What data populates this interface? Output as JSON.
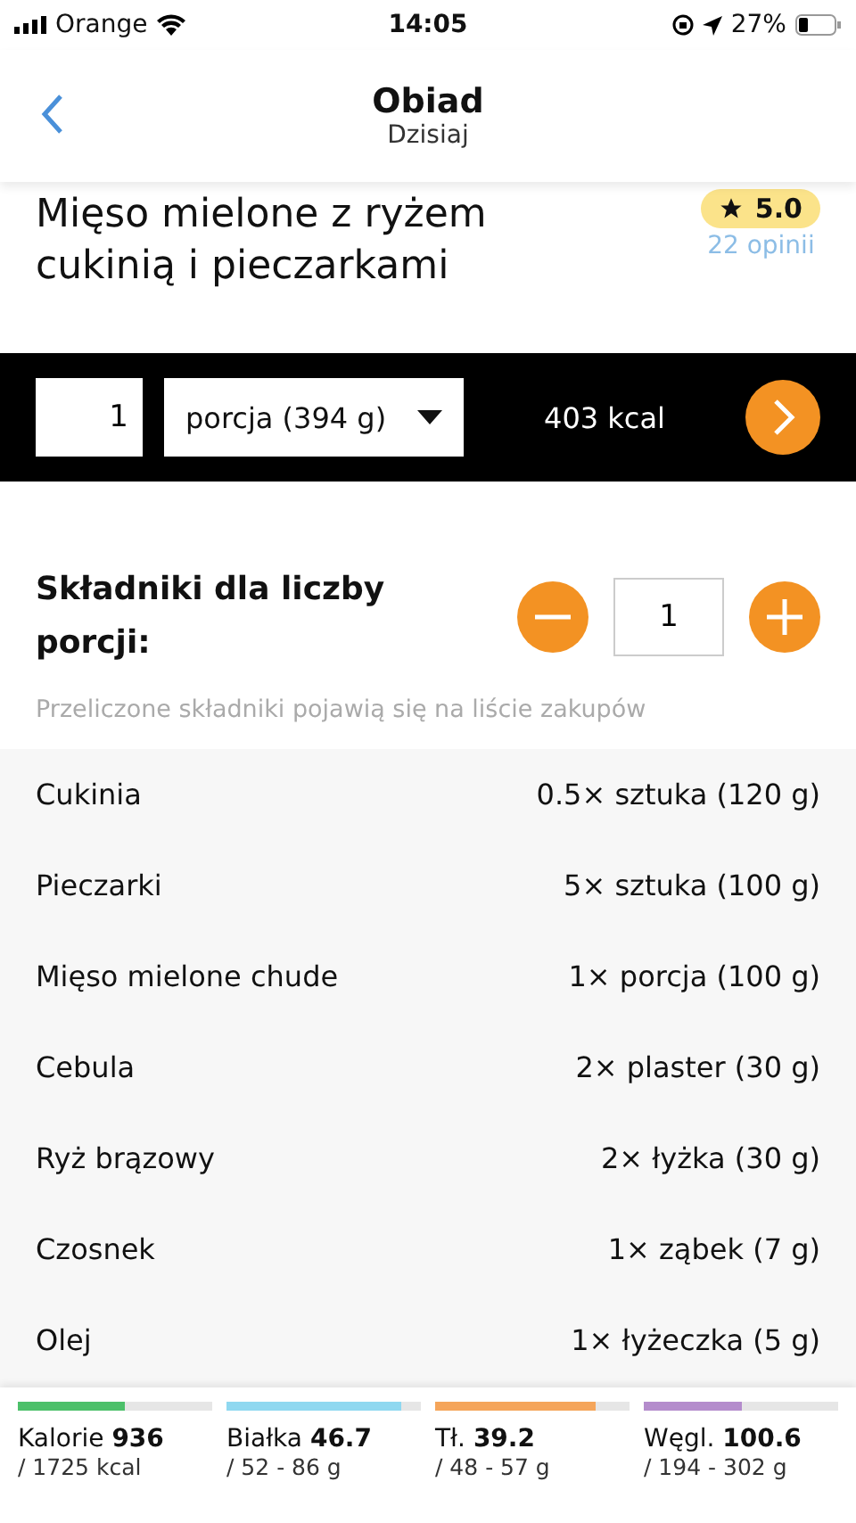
{
  "status_bar": {
    "carrier": "Orange",
    "time": "14:05",
    "battery": "27%"
  },
  "nav": {
    "title": "Obiad",
    "subtitle": "Dzisiaj"
  },
  "recipe": {
    "title": "Mięso mielone z ryżem cukinią i pieczarkami",
    "rating": "5.0",
    "reviews": "22 opinii"
  },
  "portion_bar": {
    "quantity": "1",
    "unit": "porcja (394 g)",
    "calories": "403 kcal"
  },
  "ingredients_header": {
    "title": "Składniki dla liczby porcji:",
    "servings": "1",
    "note": "Przeliczone składniki pojawią się na liście zakupów"
  },
  "ingredients": [
    {
      "name": "Cukinia",
      "amount": "0.5× sztuka (120 g)"
    },
    {
      "name": "Pieczarki",
      "amount": "5× sztuka (100 g)"
    },
    {
      "name": "Mięso mielone chude",
      "amount": "1× porcja (100 g)"
    },
    {
      "name": "Cebula",
      "amount": "2× plaster (30 g)"
    },
    {
      "name": "Ryż brązowy",
      "amount": "2× łyżka (30 g)"
    },
    {
      "name": "Czosnek",
      "amount": "1× ząbek (7 g)"
    },
    {
      "name": "Olej",
      "amount": "1× łyżeczka (5 g)"
    }
  ],
  "summary": [
    {
      "label": "Kalorie **936**",
      "target": "/ 1725 kcal",
      "level": 0.55,
      "color": "#4cc06a"
    },
    {
      "label": "Białka **46.7**",
      "target": "/ 52 - 86 g",
      "level": 0.9,
      "color": "#8fd8f0"
    },
    {
      "label": "Tł. **39.2**",
      "target": "/ 48 - 57 g",
      "level": 0.83,
      "color": "#f5a55a"
    },
    {
      "label": "Węgl. **100.6**",
      "target": "/ 194 - 302 g",
      "level": 0.5,
      "color": "#b48ccc"
    }
  ]
}
